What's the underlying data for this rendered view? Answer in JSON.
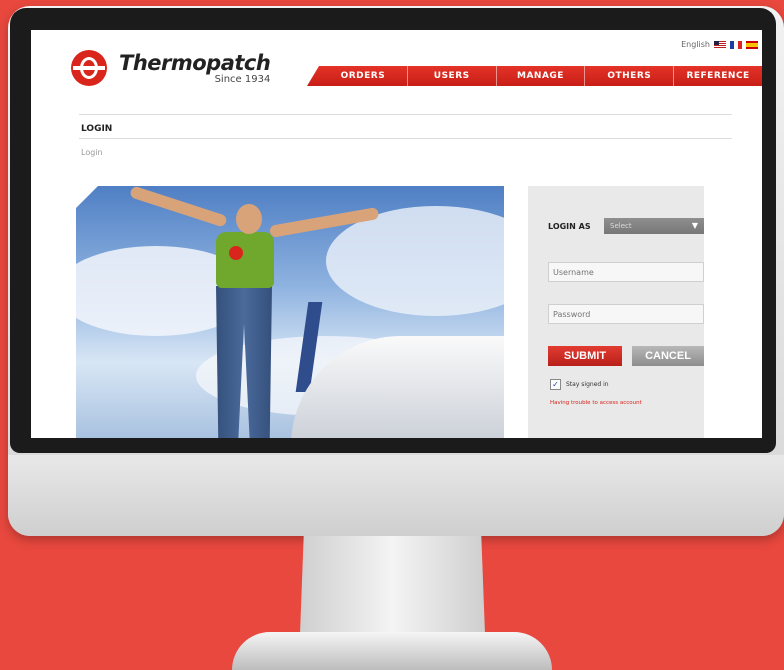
{
  "header": {
    "language": "English",
    "logo_name": "Thermopatch",
    "logo_since": "Since 1934",
    "flags": [
      "us-flag-icon",
      "fr-flag-icon",
      "es-flag-icon"
    ]
  },
  "nav": {
    "items": [
      {
        "label": "ORDERS"
      },
      {
        "label": "USERS"
      },
      {
        "label": "MANAGE"
      },
      {
        "label": "OTHERS"
      },
      {
        "label": "REFERENCE"
      }
    ]
  },
  "page": {
    "title": "LOGIN",
    "breadcrumb": "Login"
  },
  "login": {
    "login_as_label": "LOGIN AS",
    "select_value": "Select",
    "username_placeholder": "Username",
    "password_placeholder": "Password",
    "submit_label": "SUBMIT",
    "cancel_label": "CANCEL",
    "remember_label": "Stay signed in",
    "remember_checked": true,
    "trouble_link": "Having trouble to access account"
  },
  "colors": {
    "brand_red": "#d9251c",
    "background": "#e8483e"
  }
}
